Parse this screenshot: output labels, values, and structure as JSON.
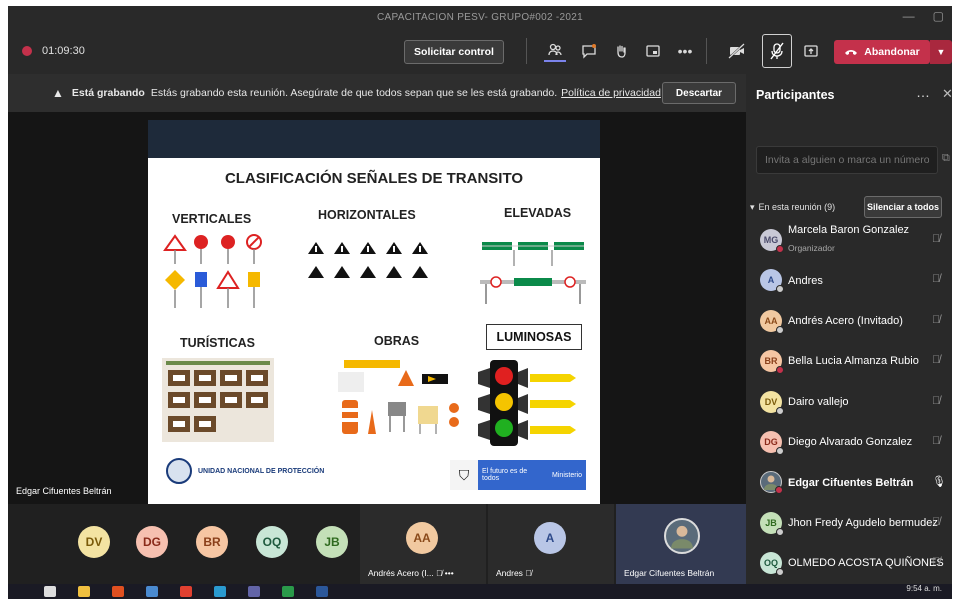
{
  "window": {
    "title": "CAPACITACION PESV- GRUPO#002 -2021"
  },
  "toolbar": {
    "timer": "01:09:30",
    "request_control_label": "Solicitar control",
    "leave_label": "Abandonar"
  },
  "banner": {
    "title": "Está grabando",
    "message": "Estás grabando esta reunión. Asegúrate de que todos sepan que se les está grabando.",
    "privacy_link": "Política de privacidad",
    "dismiss_label": "Descartar"
  },
  "slide": {
    "title": "CLASIFICACIÓN SEÑALES DE TRANSITO",
    "categories": {
      "verticales": "VERTICALES",
      "horizontales": "HORIZONTALES",
      "elevadas": "ELEVADAS",
      "turisticas": "TURÍSTICAS",
      "obras": "OBRAS",
      "luminosas": "LUMINOSAS"
    },
    "logo_text": "UNIDAD NACIONAL DE PROTECCIÓN",
    "gov_text": "El futuro es de todos",
    "gov_ministry": "Ministerio"
  },
  "presenter": {
    "name": "Edgar Cifuentes Beltrán"
  },
  "participants_panel": {
    "title": "Participantes",
    "invite_placeholder": "Invita a alguien o marca un número",
    "in_meeting_label": "En esta reunión (9)",
    "mute_all_label": "Silenciar a todos",
    "participants": [
      {
        "initials": "MG",
        "name": "Marcela Baron Gonzalez",
        "role": "Organizador",
        "color": "#c9c9d6",
        "text": "#4b4b6b"
      },
      {
        "initials": "A",
        "name": "Andres",
        "role": "",
        "color": "#b9c6e6",
        "text": "#2e4a8a"
      },
      {
        "initials": "AA",
        "name": "Andrés Acero (Invitado)",
        "role": "",
        "color": "#f1c9a0",
        "text": "#8a4a1a"
      },
      {
        "initials": "BR",
        "name": "Bella Lucia Almanza Rubio",
        "role": "",
        "color": "#f6c6a3",
        "text": "#8a3f1a"
      },
      {
        "initials": "DV",
        "name": "Dairo vallejo",
        "role": "",
        "color": "#f3e3a2",
        "text": "#7a5a0a"
      },
      {
        "initials": "DG",
        "name": "Diego Alvarado Gonzalez",
        "role": "",
        "color": "#f6c0b0",
        "text": "#8a2a1a"
      },
      {
        "initials": "",
        "name": "Edgar Cifuentes Beltrán",
        "role": "",
        "color": "#5a6b7a",
        "text": "#ffffff"
      },
      {
        "initials": "JB",
        "name": "Jhon Fredy Agudelo bermudez",
        "role": "",
        "color": "#c4e0b8",
        "text": "#2f6a1f"
      },
      {
        "initials": "OQ",
        "name": "OLMEDO ACOSTA QUIÑONES",
        "role": "",
        "color": "#c8e6d6",
        "text": "#1f5a3f"
      }
    ]
  },
  "bottom_strip": {
    "avatars": [
      {
        "initials": "DV",
        "color": "#f3e3a2",
        "text": "#7a5a0a"
      },
      {
        "initials": "DG",
        "color": "#f6c0b0",
        "text": "#8a2a1a"
      },
      {
        "initials": "BR",
        "color": "#f6c6a3",
        "text": "#8a3f1a"
      },
      {
        "initials": "OQ",
        "color": "#c8e6d6",
        "text": "#1f5a3f"
      },
      {
        "initials": "JB",
        "color": "#c4e0b8",
        "text": "#2f6a1f"
      }
    ],
    "tiles": [
      {
        "initials": "AA",
        "label": "Andrés Acero (I...",
        "color": "#f1c9a0",
        "text": "#8a4a1a"
      },
      {
        "initials": "A",
        "label": "Andres",
        "color": "#b9c6e6",
        "text": "#2e4a8a"
      },
      {
        "initials": "",
        "label": "Edgar Cifuentes Beltrán",
        "color": "#5a6b7a",
        "text": "#ffffff"
      }
    ]
  },
  "taskbar": {
    "time": "9:54 a. m."
  }
}
